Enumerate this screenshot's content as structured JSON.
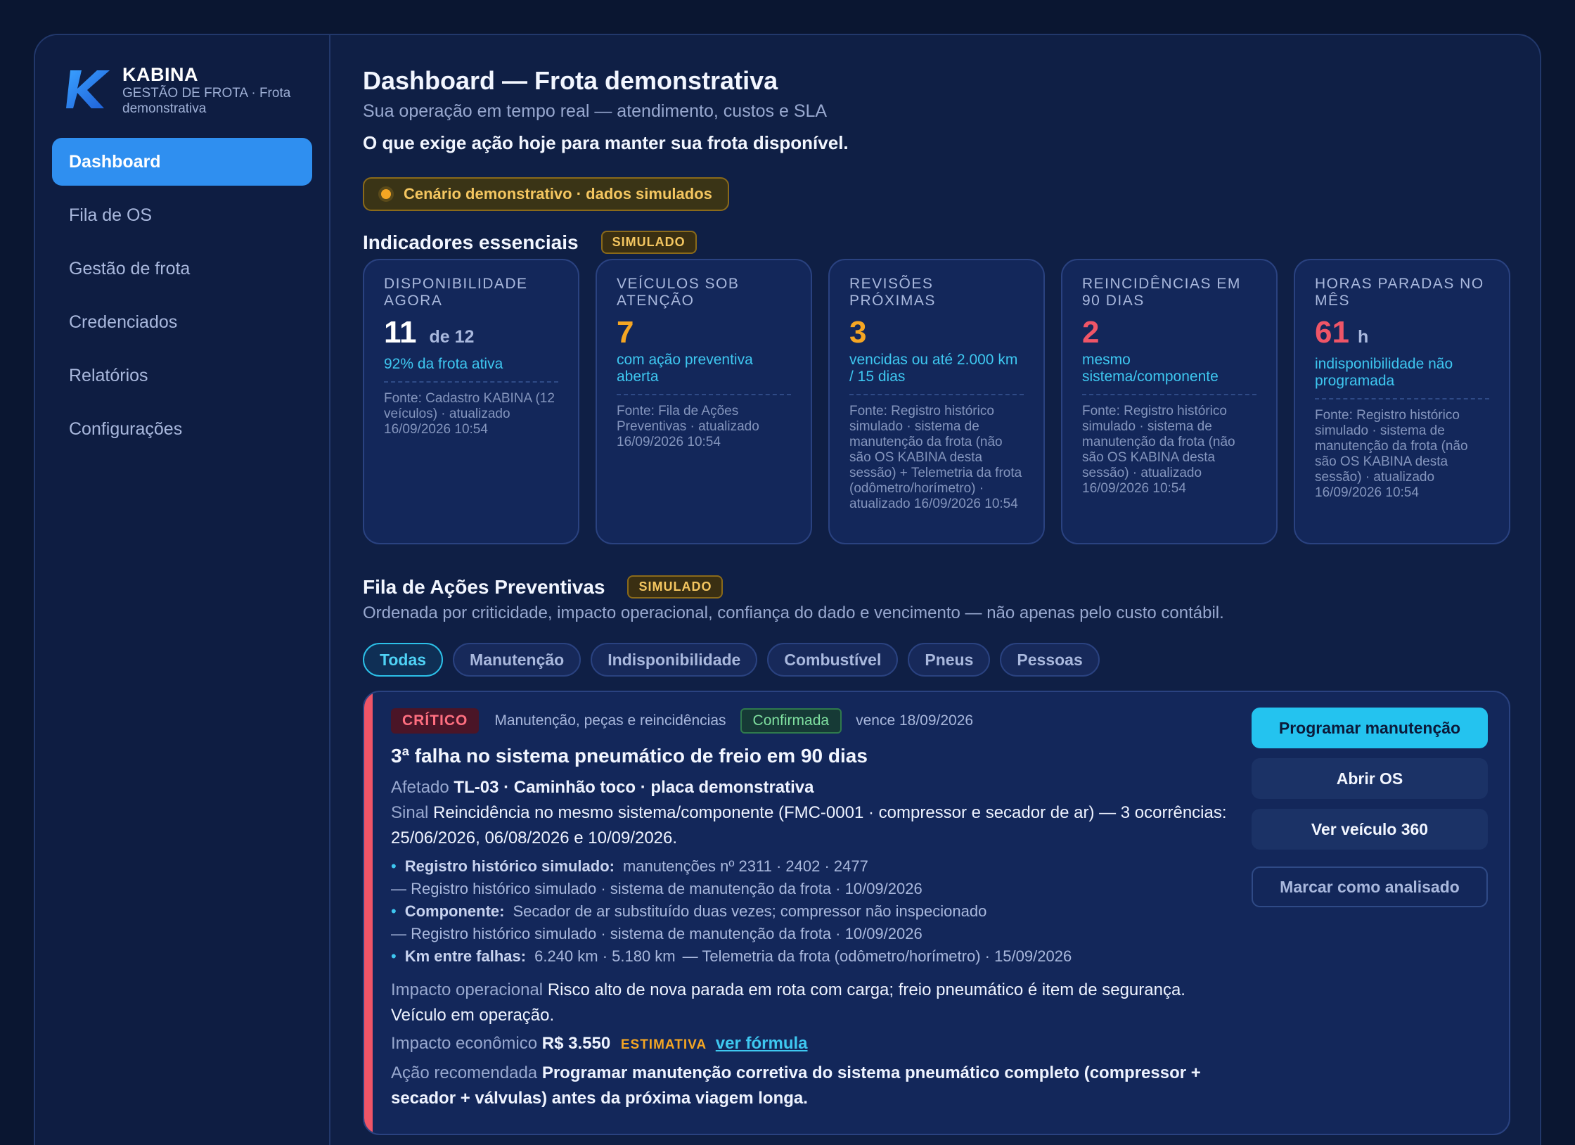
{
  "brand": {
    "name": "KABINA",
    "subtitle": "GESTÃO DE FROTA · Frota demonstrativa",
    "logo_icon": "kabina-k-logo",
    "accent": "#2f8ff0"
  },
  "nav": {
    "items": [
      {
        "label": "Dashboard",
        "active": true
      },
      {
        "label": "Fila de OS"
      },
      {
        "label": "Gestão de frota"
      },
      {
        "label": "Credenciados"
      },
      {
        "label": "Relatórios"
      },
      {
        "label": "Configurações"
      }
    ]
  },
  "header": {
    "title": "Dashboard — Frota demonstrativa",
    "subtitle": "Sua operação em tempo real — atendimento, custos e SLA",
    "lead": "O que exige ação hoje para manter sua frota disponível.",
    "demo_notice": "Cenário demonstrativo · dados simulados"
  },
  "kpi_section": {
    "title": "Indicadores essenciais",
    "badge": "SIMULADO",
    "cards": [
      {
        "label": "DISPONIBILIDADE AGORA",
        "value": "11",
        "unit": "de 12",
        "value_color": "#ffffff",
        "desc": "92% da frota ativa",
        "source": "Fonte: Cadastro KABINA (12 veículos) · atualizado 16/09/2026 10:54"
      },
      {
        "label": "VEÍCULOS SOB ATENÇÃO",
        "value": "7",
        "unit": "",
        "value_color": "#f5a623",
        "desc": "com ação preventiva aberta",
        "source": "Fonte: Fila de Ações Preventivas · atualizado 16/09/2026 10:54"
      },
      {
        "label": "REVISÕES PRÓXIMAS",
        "value": "3",
        "unit": "",
        "value_color": "#f5a623",
        "desc": "vencidas ou até 2.000 km / 15 dias",
        "source": "Fonte: Registro histórico simulado · sistema de manutenção da frota (não são OS KABINA desta sessão) + Telemetria da frota (odômetro/horímetro) · atualizado 16/09/2026 10:54"
      },
      {
        "label": "REINCIDÊNCIAS EM 90 DIAS",
        "value": "2",
        "unit": "",
        "value_color": "#ef5567",
        "desc": "mesmo sistema/componente",
        "source": "Fonte: Registro histórico simulado · sistema de manutenção da frota (não são OS KABINA desta sessão) · atualizado 16/09/2026 10:54"
      },
      {
        "label": "HORAS PARADAS NO MÊS",
        "value": "61",
        "unit": "h",
        "value_color": "#ef5567",
        "desc": "indisponibilidade não programada",
        "source": "Fonte: Registro histórico simulado · sistema de manutenção da frota (não são OS KABINA desta sessão) · atualizado 16/09/2026 10:54"
      }
    ]
  },
  "queue": {
    "title": "Fila de Ações Preventivas",
    "badge": "SIMULADO",
    "description": "Ordenada por criticidade, impacto operacional, confiança do dado e vencimento — não apenas pelo custo contábil.",
    "filters": [
      {
        "label": "Todas",
        "active": true
      },
      {
        "label": "Manutenção"
      },
      {
        "label": "Indisponibilidade"
      },
      {
        "label": "Combustível"
      },
      {
        "label": "Pneus"
      },
      {
        "label": "Pessoas"
      }
    ],
    "card": {
      "severity": "CRÍTICO",
      "category": "Manutenção, peças e reincidências",
      "status": "Confirmada",
      "due": "vence 18/09/2026",
      "title": "3ª falha no sistema pneumático de freio em 90 dias",
      "afetado_label": "Afetado",
      "afetado_value": "TL-03 · Caminhão toco · placa demonstrativa",
      "sinal_label": "Sinal",
      "sinal_value": "Reincidência no mesmo sistema/componente (FMC-0001 · compressor e secador de ar) — 3 ocorrências: 25/06/2026, 06/08/2026 e 10/09/2026.",
      "bullets": [
        {
          "key": "Registro histórico simulado:",
          "value": "manutenções nº 2311 · 2402 · 2477",
          "source": "— Registro histórico simulado · sistema de manutenção da frota · 10/09/2026"
        },
        {
          "key": "Componente:",
          "value": "Secador de ar substituído duas vezes; compressor não inspecionado",
          "source": "— Registro histórico simulado · sistema de manutenção da frota · 10/09/2026"
        },
        {
          "key": "Km entre falhas:",
          "value": "6.240 km · 5.180 km",
          "source": "— Telemetria da frota (odômetro/horímetro) · 15/09/2026"
        }
      ],
      "impacto_op_label": "Impacto operacional",
      "impacto_op_value": "Risco alto de nova parada em rota com carga; freio pneumático é item de segurança. Veículo em operação.",
      "impacto_ec_label": "Impacto econômico",
      "impacto_ec_value": "R$ 3.550",
      "impacto_ec_tag": "ESTIMATIVA",
      "formula_link": "ver fórmula",
      "acao_label": "Ação recomendada",
      "acao_value": "Programar manutenção corretiva do sistema pneumático completo (compressor + secador + válvulas) antes da próxima viagem longa.",
      "actions": {
        "primary": "Programar manutenção",
        "open_os": "Abrir OS",
        "vehicle": "Ver veículo 360",
        "mark": "Marcar como analisado"
      }
    }
  }
}
